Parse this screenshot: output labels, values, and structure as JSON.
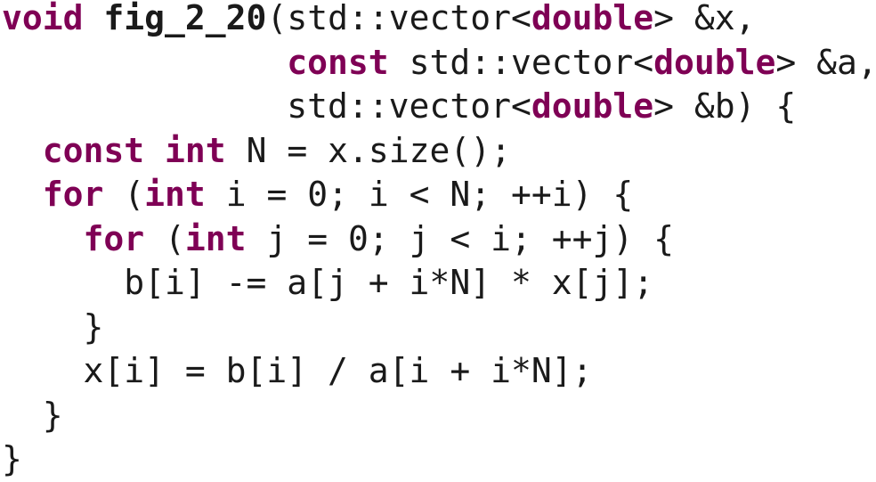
{
  "code": {
    "language": "C++",
    "lines": [
      [
        {
          "t": "void",
          "c": "kw"
        },
        {
          "t": " ",
          "c": "tx"
        },
        {
          "t": "fig_2_20",
          "c": "fn"
        },
        {
          "t": "(std::vector<",
          "c": "tx"
        },
        {
          "t": "double",
          "c": "kw"
        },
        {
          "t": "> &x,",
          "c": "tx"
        }
      ],
      [
        {
          "t": "              ",
          "c": "tx"
        },
        {
          "t": "const",
          "c": "kw"
        },
        {
          "t": " std::vector<",
          "c": "tx"
        },
        {
          "t": "double",
          "c": "kw"
        },
        {
          "t": "> &a,",
          "c": "tx"
        }
      ],
      [
        {
          "t": "              std::vector<",
          "c": "tx"
        },
        {
          "t": "double",
          "c": "kw"
        },
        {
          "t": "> &b) {",
          "c": "tx"
        }
      ],
      [
        {
          "t": "  ",
          "c": "tx"
        },
        {
          "t": "const",
          "c": "kw"
        },
        {
          "t": " ",
          "c": "tx"
        },
        {
          "t": "int",
          "c": "kw"
        },
        {
          "t": " N = x.size();",
          "c": "tx"
        }
      ],
      [
        {
          "t": "  ",
          "c": "tx"
        },
        {
          "t": "for",
          "c": "kw"
        },
        {
          "t": " (",
          "c": "tx"
        },
        {
          "t": "int",
          "c": "kw"
        },
        {
          "t": " i = 0; i < N; ++i) {",
          "c": "tx"
        }
      ],
      [
        {
          "t": "    ",
          "c": "tx"
        },
        {
          "t": "for",
          "c": "kw"
        },
        {
          "t": " (",
          "c": "tx"
        },
        {
          "t": "int",
          "c": "kw"
        },
        {
          "t": " j = 0; j < i; ++j) {",
          "c": "tx"
        }
      ],
      [
        {
          "t": "      b[i] -= a[j + i*N] * x[j];",
          "c": "tx"
        }
      ],
      [
        {
          "t": "    }",
          "c": "tx"
        }
      ],
      [
        {
          "t": "    x[i] = b[i] / a[i + i*N];",
          "c": "tx"
        }
      ],
      [
        {
          "t": "  }",
          "c": "tx"
        }
      ],
      [
        {
          "t": "}",
          "c": "tx"
        }
      ]
    ]
  },
  "colors": {
    "keyword": "#7f0055",
    "text": "#1a1a1a",
    "background": "#ffffff"
  }
}
